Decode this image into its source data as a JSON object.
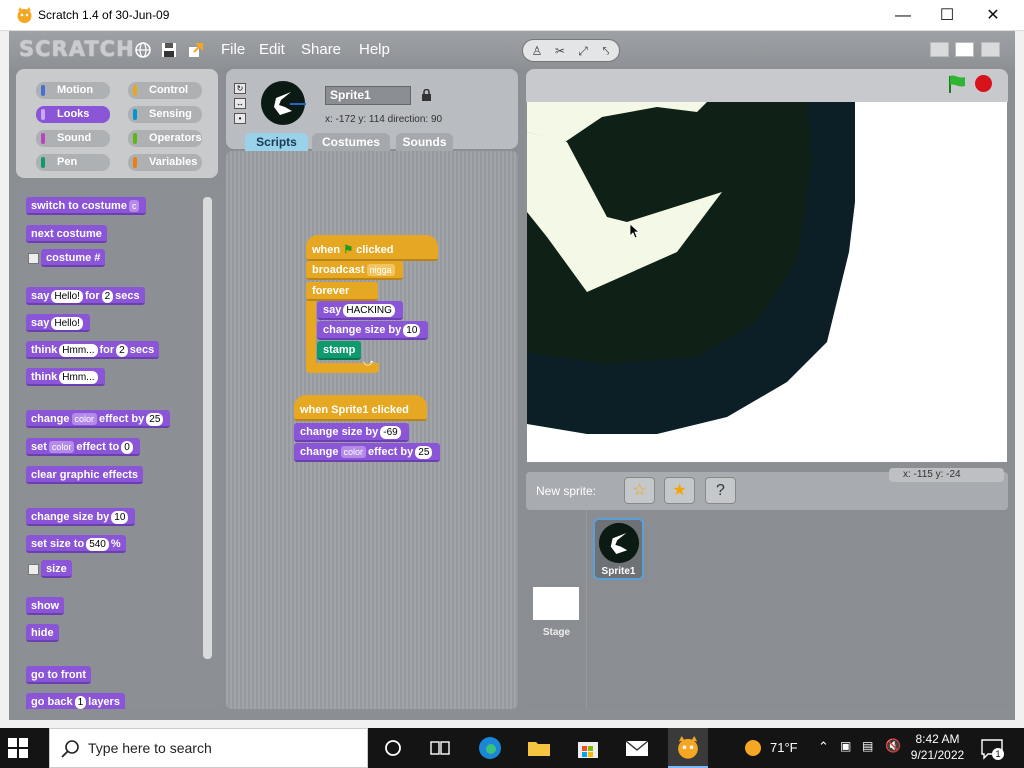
{
  "window": {
    "title": "Scratch 1.4 of 30-Jun-09"
  },
  "app": {
    "logo": "SCRATCH",
    "menus": [
      "File",
      "Edit",
      "Share",
      "Help"
    ]
  },
  "categories": [
    {
      "label": "Motion",
      "color": "#4a6cd4"
    },
    {
      "label": "Control",
      "color": "#e6a822"
    },
    {
      "label": "Looks",
      "color": "#8a55d7"
    },
    {
      "label": "Sensing",
      "color": "#0096d6"
    },
    {
      "label": "Sound",
      "color": "#bb42c3"
    },
    {
      "label": "Operators",
      "color": "#5cb712"
    },
    {
      "label": "Pen",
      "color": "#0e9a6c"
    },
    {
      "label": "Variables",
      "color": "#ee7d16"
    }
  ],
  "palette": {
    "switch_costume": "switch to costume",
    "switch_dd": "c",
    "next_costume": "next costume",
    "costume_num": "costume #",
    "say_for": "say",
    "say_for_val": "Hello!",
    "say_for_mid": "for",
    "say_for_secs": "2",
    "say_for_end": "secs",
    "say": "say",
    "say_val": "Hello!",
    "think_for": "think",
    "think_for_val": "Hmm...",
    "think_for_mid": "for",
    "think_for_secs": "2",
    "think_for_end": "secs",
    "think": "think",
    "think_val": "Hmm...",
    "change_effect": "change",
    "change_effect_dd": "color",
    "change_effect_mid": "effect by",
    "change_effect_val": "25",
    "set_effect": "set",
    "set_effect_dd": "color",
    "set_effect_mid": "effect to",
    "set_effect_val": "0",
    "clear_effects": "clear graphic effects",
    "change_size": "change size by",
    "change_size_val": "10",
    "set_size": "set size to",
    "set_size_val": "540",
    "set_size_end": "%",
    "size": "size",
    "show": "show",
    "hide": "hide",
    "go_front": "go to front",
    "go_back": "go back",
    "go_back_val": "1",
    "go_back_end": "layers"
  },
  "sprite": {
    "name": "Sprite1",
    "coords": "x: -172  y: 114   direction: 90"
  },
  "tabs": [
    "Scripts",
    "Costumes",
    "Sounds"
  ],
  "scripts": {
    "s1_hat_a": "when",
    "s1_hat_b": "clicked",
    "broadcast": "broadcast",
    "broadcast_dd": "nigga",
    "forever": "forever",
    "say": "say",
    "say_val": "HACKING",
    "change_size": "change size by",
    "change_size_val": "10",
    "stamp": "stamp",
    "s2_hat": "when Sprite1 clicked",
    "s2_change_size": "change size by",
    "s2_change_size_val": "-69",
    "s2_change": "change",
    "s2_change_dd": "color",
    "s2_change_mid": "effect by",
    "s2_change_val": "25"
  },
  "stage": {
    "mouse": "x: -115   y: -24"
  },
  "new_sprite": {
    "label": "New sprite:"
  },
  "sprites": {
    "stage_label": "Stage",
    "sprite1_label": "Sprite1"
  },
  "taskbar": {
    "search_placeholder": "Type here to search",
    "temperature": "71°F",
    "time": "8:42 AM",
    "date": "9/21/2022",
    "notifications": "1"
  }
}
